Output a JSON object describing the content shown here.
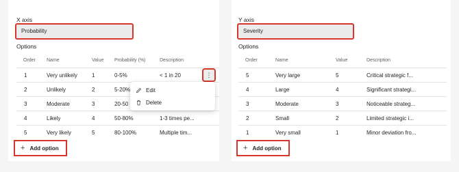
{
  "x_axis": {
    "label": "X axis",
    "value": "Probability",
    "options_label": "Options",
    "columns": [
      "Order",
      "Name",
      "Value",
      "Probability (%)",
      "Description"
    ],
    "rows": [
      {
        "order": "1",
        "name": "Very unlikely",
        "value": "1",
        "probability": "0-5%",
        "description": "< 1 in 20"
      },
      {
        "order": "2",
        "name": "Unlikely",
        "value": "2",
        "probability": "5-20%",
        "description": ""
      },
      {
        "order": "3",
        "name": "Moderate",
        "value": "3",
        "probability": "20-50",
        "description": ""
      },
      {
        "order": "4",
        "name": "Likely",
        "value": "4",
        "probability": "50-80%",
        "description": "1-3 times pe..."
      },
      {
        "order": "5",
        "name": "Very likely",
        "value": "5",
        "probability": "80-100%",
        "description": "Multiple tim..."
      }
    ],
    "more_icon": "⋮",
    "menu": {
      "edit_label": "Edit",
      "delete_label": "Delete"
    },
    "add_label": "Add option"
  },
  "y_axis": {
    "label": "Y axis",
    "value": "Severity",
    "options_label": "Options",
    "columns": [
      "Order",
      "Name",
      "Value",
      "Description"
    ],
    "rows": [
      {
        "order": "5",
        "name": "Very large",
        "value": "5",
        "description": "Critical strategic f..."
      },
      {
        "order": "4",
        "name": "Large",
        "value": "4",
        "description": "Significant strategi..."
      },
      {
        "order": "3",
        "name": "Moderate",
        "value": "3",
        "description": "Noticeable strateg..."
      },
      {
        "order": "2",
        "name": "Small",
        "value": "2",
        "description": "Limited strategic i..."
      },
      {
        "order": "1",
        "name": "Very small",
        "value": "1",
        "description": "Minor deviation fro..."
      }
    ],
    "add_label": "Add option"
  },
  "plus_icon": "+",
  "colors": {
    "highlight": "#d9362b",
    "field_bg": "#ebebeb",
    "page_bg": "#f5f5f5"
  }
}
